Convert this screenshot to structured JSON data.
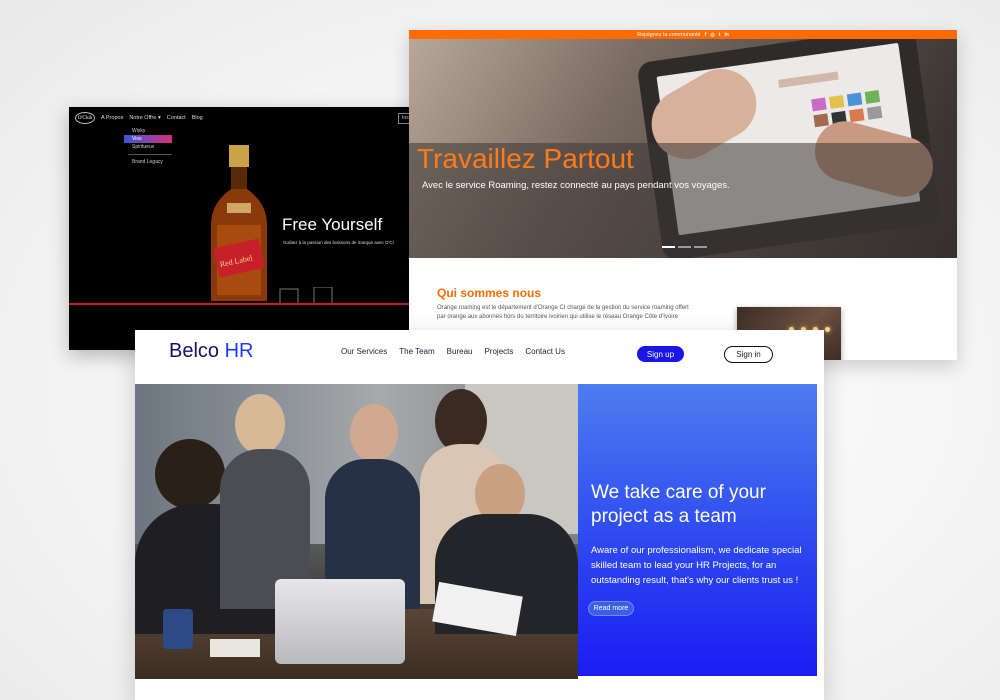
{
  "oclub": {
    "logo": "O'Club",
    "nav": [
      "A Propos",
      "Notre Offre",
      "Contact",
      "Blog"
    ],
    "nav_button": "Ins",
    "dropdown": [
      "Wisky",
      "Vins",
      "Spiritueux",
      "Brand Legacy"
    ],
    "hero_title": "Free Yourself",
    "hero_subtitle": "Goûtez à la passion des boissons de marque avec O'Cl",
    "bottle_label": "Red Label"
  },
  "orange": {
    "topbar_text": "Rejoignez la communauté",
    "social_icons": [
      "f",
      "◎",
      "t",
      "in"
    ],
    "hero_title": "Travaillez Partout",
    "hero_subtitle": "Avec le service Roaming, restez connecté au pays pendant vos voyages.",
    "about_title": "Qui sommes nous",
    "about_text": "Orange roaming est le département d'Orange CI chargé de la gestion du service roaming offert par orange aux abonnés hors du territoire ivoirien qui utilise le réseau Orange Côte d'Ivoire"
  },
  "belco": {
    "logo_main": "Belco",
    "logo_accent": "HR",
    "nav": [
      "Our Services",
      "The Team",
      "Bureau",
      "Projects",
      "Contact Us"
    ],
    "signup_label": "Sign up",
    "signin_label": "Sign in",
    "heading": "We take care of your project as a team",
    "text": "Aware of our professionalism, we dedicate special skilled team to lead your HR Projects, for an outstanding result, that's why our clients trust us !",
    "more_label": "Read more"
  },
  "colors": {
    "orange_brand": "#ff6b00",
    "belco_blue": "#1a16e8",
    "oclub_red": "#c81f25"
  }
}
